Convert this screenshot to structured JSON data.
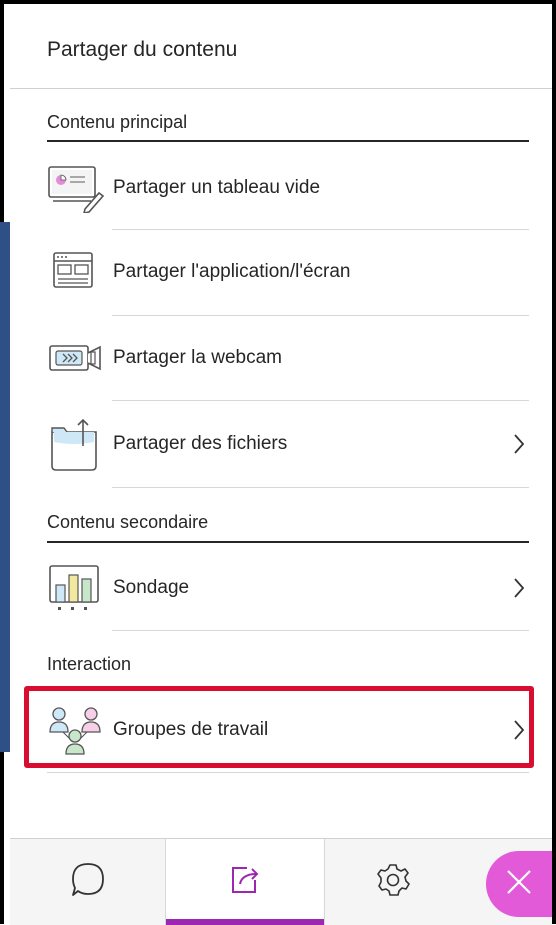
{
  "panel": {
    "title": "Partager du contenu"
  },
  "sections": {
    "main": {
      "header": "Contenu principal"
    },
    "secondary": {
      "header": "Contenu secondaire"
    },
    "interaction": {
      "header": "Interaction"
    }
  },
  "items": {
    "whiteboard": {
      "label": "Partager un tableau vide",
      "icon": "whiteboard-icon"
    },
    "application": {
      "label": "Partager l'application/l'écran",
      "icon": "application-window-icon"
    },
    "webcam": {
      "label": "Partager la webcam",
      "icon": "webcam-icon"
    },
    "files": {
      "label": "Partager des fichiers",
      "icon": "folder-upload-icon"
    },
    "poll": {
      "label": "Sondage",
      "icon": "poll-chart-icon"
    },
    "breakout": {
      "label": "Groupes de travail",
      "icon": "breakout-groups-icon"
    }
  },
  "bottom_bar": {
    "tabs": [
      "chat-icon",
      "share-content-icon",
      "settings-gear-icon"
    ],
    "active_tab": "share-content-icon",
    "close": "close-icon"
  },
  "colors": {
    "accent": "#9c27b0",
    "close_button": "#e25ad8",
    "highlight": "#d90d2f",
    "side_strip": "#2f4f87"
  }
}
